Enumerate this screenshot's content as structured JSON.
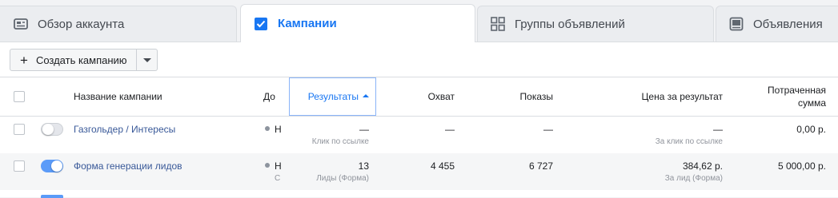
{
  "tabs": [
    {
      "label": "Обзор аккаунта",
      "icon": "account-overview-icon"
    },
    {
      "label": "Кампании",
      "icon": "checkbox-checked-icon"
    },
    {
      "label": "Группы объявлений",
      "icon": "grid-icon"
    },
    {
      "label": "Объявления",
      "icon": "ad-preview-icon"
    }
  ],
  "toolbar": {
    "create_label": "Создать кампанию"
  },
  "columns": {
    "name": "Название кампании",
    "delivery": "До",
    "results": "Результаты",
    "reach": "Охват",
    "impressions": "Показы",
    "cost_per_result": "Цена за результат",
    "spent_line1": "Потраченная",
    "spent_line2": "сумма"
  },
  "rows": [
    {
      "name": "Газгольдер / Интересы",
      "enabled": false,
      "delivery": "Н",
      "delivery_sub": "",
      "results": "—",
      "results_sub": "Клик по ссылке",
      "reach": "—",
      "impressions": "—",
      "cost": "—",
      "cost_sub": "За клик по ссылке",
      "spent": "0,00 р."
    },
    {
      "name": "Форма генерации лидов",
      "enabled": true,
      "delivery": "Н",
      "delivery_sub": "С",
      "results": "13",
      "results_sub": "Лиды (Форма)",
      "reach": "4 455",
      "impressions": "6 727",
      "cost": "384,62 р.",
      "cost_sub": "За лид (Форма)",
      "spent": "5 000,00 р."
    }
  ],
  "colors": {
    "accent": "#1876f2",
    "link": "#385898",
    "toggle_on": "#5b9bf8"
  }
}
